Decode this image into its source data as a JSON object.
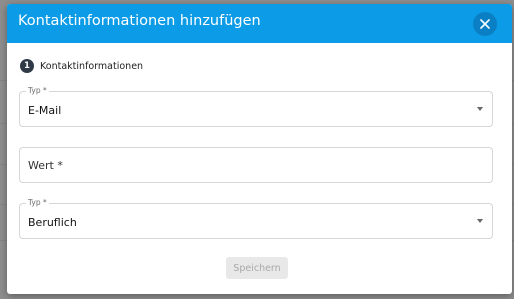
{
  "dialog": {
    "title": "Kontaktinformationen hinzufügen",
    "close_icon": "close-icon",
    "step": {
      "number": "1",
      "label": "Kontaktinformationen"
    },
    "fields": {
      "type1": {
        "legend": "Typ *",
        "value": "E-Mail"
      },
      "wert": {
        "placeholder": "Wert *"
      },
      "type2": {
        "legend": "Typ *",
        "value": "Beruflich"
      }
    },
    "save_label": "Speichern"
  },
  "colors": {
    "header": "#0c9be6",
    "close_button": "#0a7fc4",
    "step_badge": "#2f3a46",
    "save_disabled_bg": "#e8e8e8"
  }
}
